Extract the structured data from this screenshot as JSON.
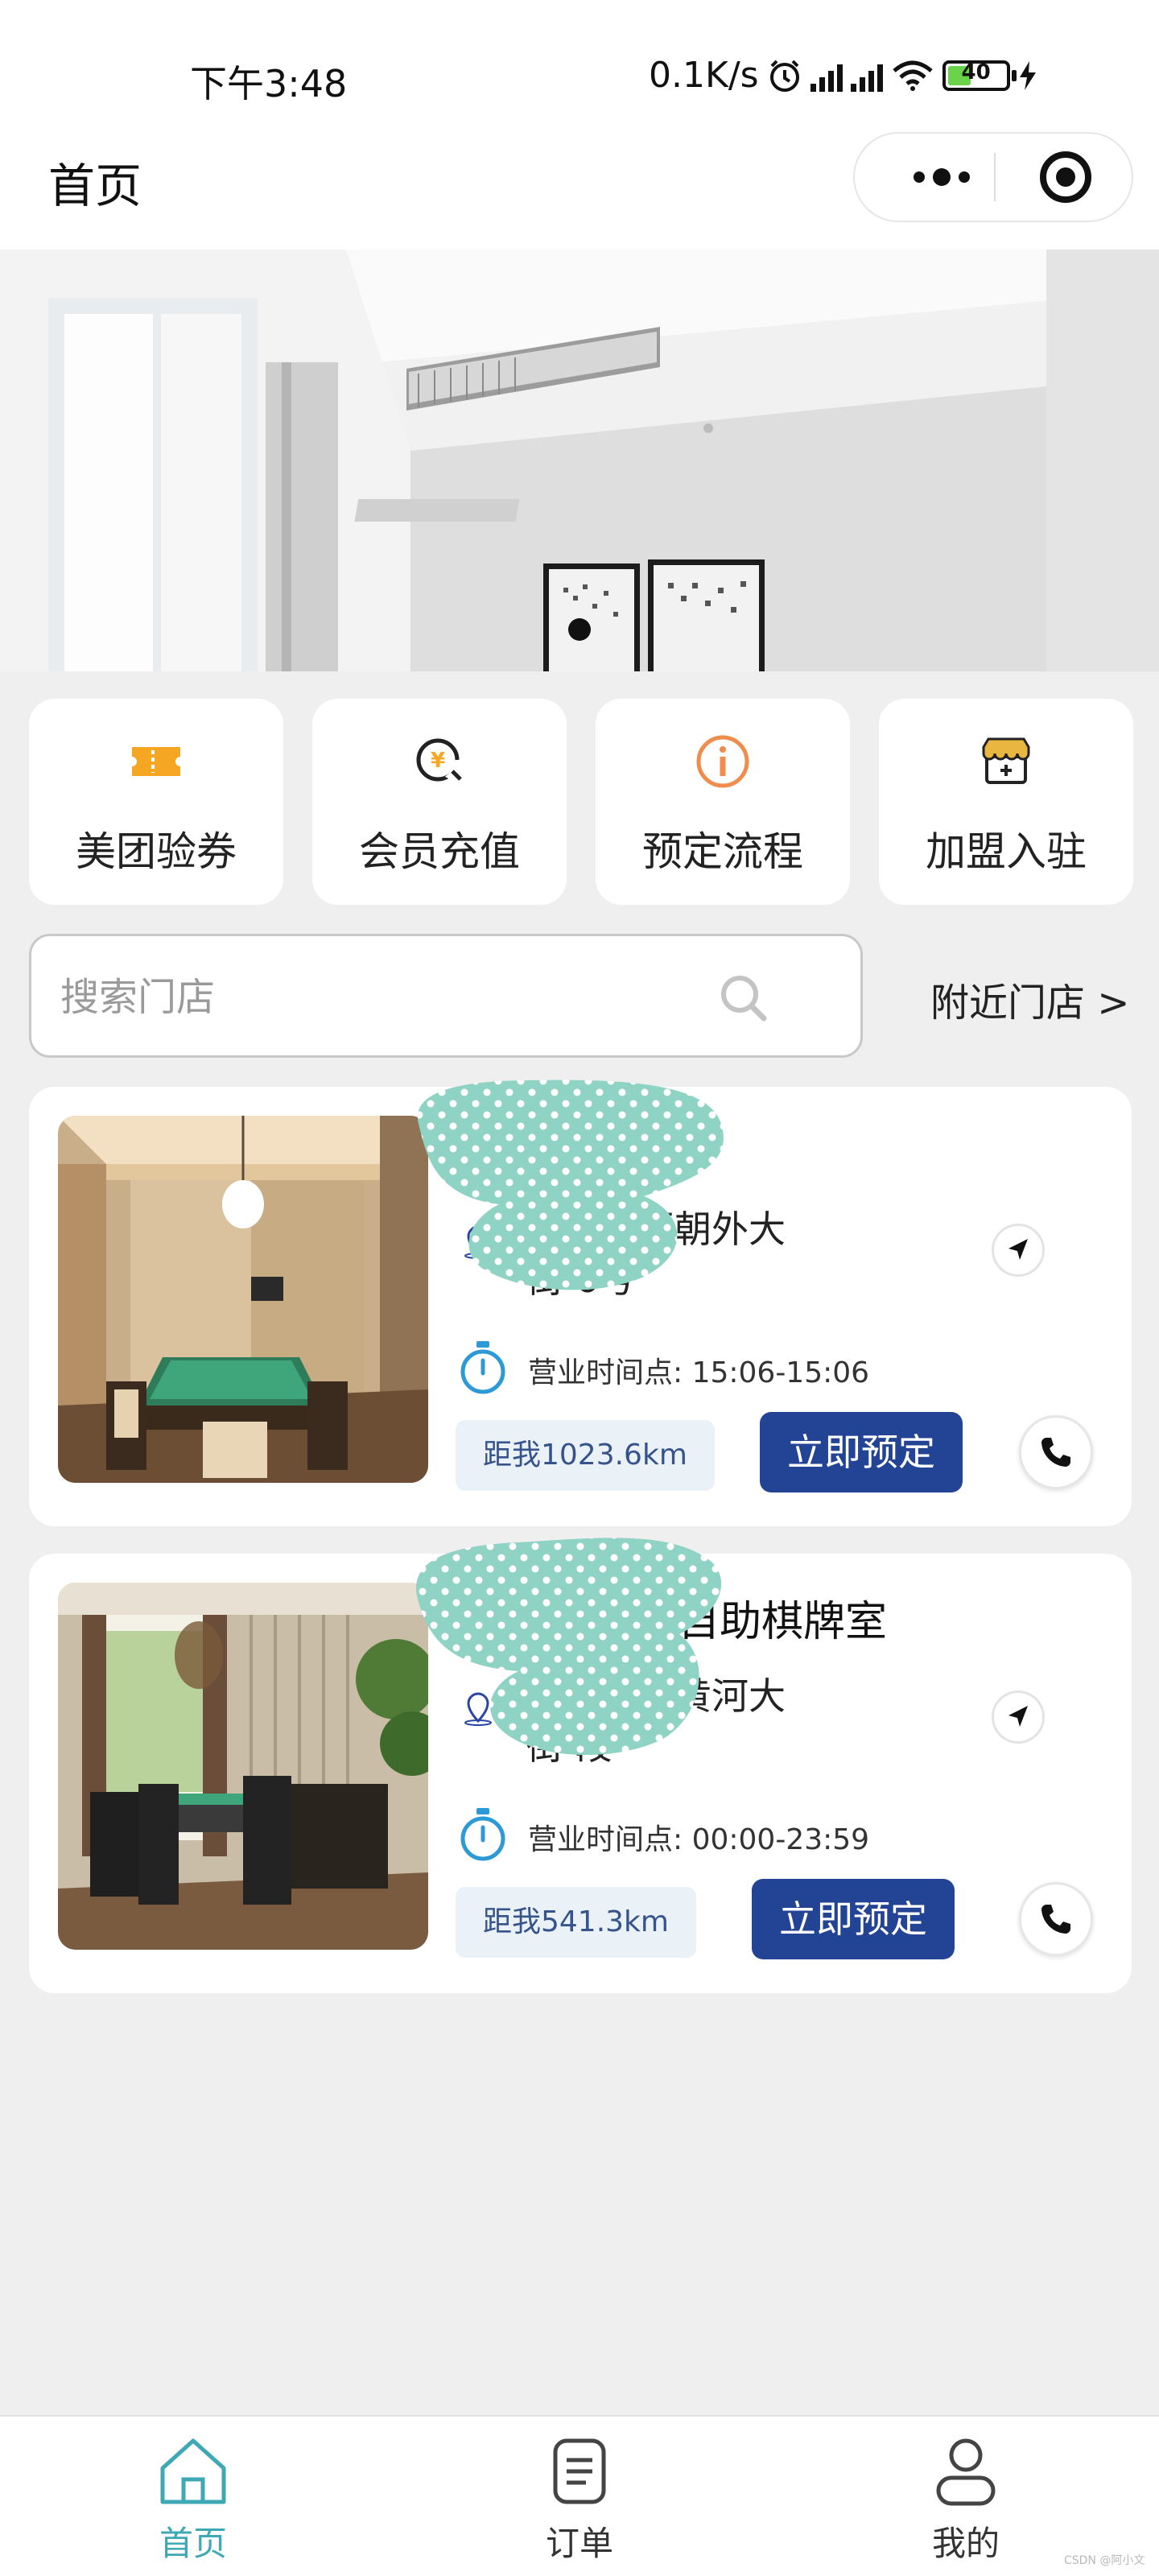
{
  "status_bar": {
    "time": "下午3:48",
    "network_speed": "0.1K/s",
    "battery": "40",
    "icons": [
      "alarm-icon",
      "hd-signal-icon",
      "hd-signal-icon",
      "wifi-icon",
      "battery-icon",
      "charging-icon"
    ]
  },
  "nav": {
    "title": "首页",
    "capsule_icons": [
      "more-icon",
      "target-icon"
    ]
  },
  "quick_actions": [
    {
      "label": "美团验券",
      "icon": "ticket-icon",
      "color": "#f5a623"
    },
    {
      "label": "会员充值",
      "icon": "recharge-icon",
      "color": "#f5a623"
    },
    {
      "label": "预定流程",
      "icon": "info-icon",
      "color": "#f08c4c"
    },
    {
      "label": "加盟入驻",
      "icon": "store-icon",
      "color": "#e9b640"
    }
  ],
  "search": {
    "placeholder": "搜索门店",
    "nearby": "附近门店 >"
  },
  "stores": [
    {
      "name": "",
      "address": "市朝阳区朝外大\n街 6号",
      "hours": "营业时间点: 15:06-15:06",
      "distance": "距我1023.6km",
      "book": "立即预定"
    },
    {
      "name": "自助棋牌室",
      "address": "市龙亭区黄河大\n街 段",
      "hours": "营业时间点: 00:00-23:59",
      "distance": "距我541.3km",
      "book": "立即预定"
    }
  ],
  "tabs": [
    {
      "label": "首页",
      "icon": "home-icon",
      "active": true
    },
    {
      "label": "订单",
      "icon": "order-icon",
      "active": false
    },
    {
      "label": "我的",
      "icon": "profile-icon",
      "active": false
    }
  ],
  "watermark": "CSDN @阿小文",
  "colors": {
    "accent": "#234495",
    "tab_active": "#3fa8b5",
    "redaction": "#8fd3c4"
  }
}
